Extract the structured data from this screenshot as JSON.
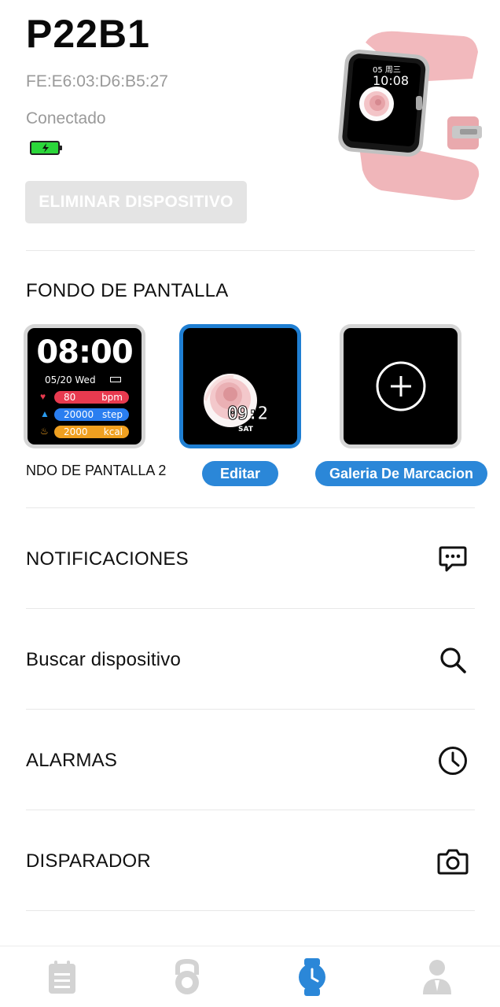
{
  "device": {
    "name": "P22B1",
    "mac": "FE:E6:03:D6:B5:27",
    "status": "Conectado",
    "battery_icon": "battery-charging-icon",
    "battery_color": "#2bd63a",
    "remove_label": "ELIMINAR DISPOSITIVO",
    "hero_image": "smartwatch-pink-image",
    "hero_watch": {
      "date": "05 周三",
      "time": "10:08"
    }
  },
  "wallpaper": {
    "title": "FONDO DE PANTALLA",
    "faces": [
      {
        "label": "NDO DE PANTALLA 2",
        "time": "08:00",
        "date": "05/20  Wed",
        "rows": [
          {
            "icon": "heart-icon",
            "value": "80",
            "unit": "bpm",
            "color": "#e83a4f"
          },
          {
            "icon": "shoe-icon",
            "value": "20000",
            "unit": "step",
            "color": "#2a7ef0"
          },
          {
            "icon": "flame-icon",
            "value": "2000",
            "unit": "kcal",
            "color": "#f0a020"
          }
        ]
      },
      {
        "time": "09:2",
        "day": "SAT",
        "selected": true,
        "action": "Editar"
      },
      {
        "icon": "add-circle-icon",
        "action": "Galeria De Marcacion"
      }
    ]
  },
  "menu": [
    {
      "label": "NOTIFICACIONES",
      "icon": "message-dots-icon"
    },
    {
      "label": "Buscar dispositivo",
      "icon": "search-icon"
    },
    {
      "label": "ALARMAS",
      "icon": "clock-icon"
    },
    {
      "label": "DISPARADOR",
      "icon": "camera-icon"
    }
  ],
  "bottom_nav": [
    {
      "icon": "notes-icon",
      "active": false
    },
    {
      "icon": "kettlebell-icon",
      "active": false
    },
    {
      "icon": "watch-icon",
      "active": true
    },
    {
      "icon": "user-icon",
      "active": false
    }
  ],
  "colors": {
    "accent": "#2b87d8",
    "inactive_nav": "#d3d3d3",
    "active_nav": "#2b87d8"
  }
}
